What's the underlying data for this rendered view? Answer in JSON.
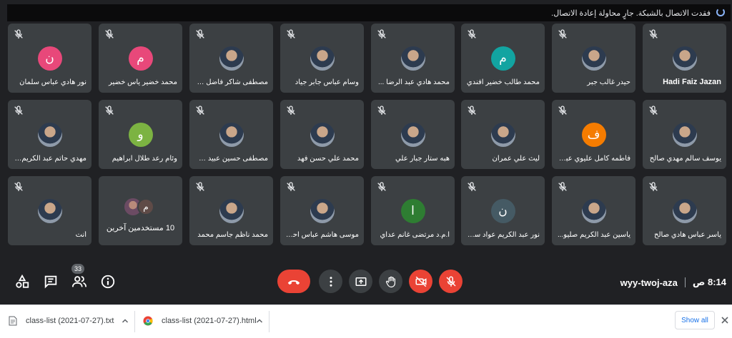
{
  "notification": {
    "text": "فقدت الاتصال بالشبكة. جارٍ محاولة إعادة الاتصال."
  },
  "tiles": [
    {
      "name": "Hadi Faiz Jazan",
      "avatar": "photo",
      "color": "",
      "letter": "",
      "ltr": true
    },
    {
      "name": "حيدر غالب جبر",
      "avatar": "photo",
      "color": "",
      "letter": ""
    },
    {
      "name": "محمد طالب خضير افندي",
      "avatar": "letter",
      "color": "#12a4a1",
      "letter": "م"
    },
    {
      "name": "محمد هادي عبد الرضا ...",
      "avatar": "photo",
      "color": "",
      "letter": ""
    },
    {
      "name": "وسام عباس جابر جياد",
      "avatar": "photo",
      "color": "",
      "letter": ""
    },
    {
      "name": "مصطفى شاكر فاضل ع...",
      "avatar": "photo",
      "color": "",
      "letter": ""
    },
    {
      "name": "محمد خضير ياس خضير",
      "avatar": "letter",
      "color": "#e8487a",
      "letter": "م"
    },
    {
      "name": "نور هادي عباس سلمان",
      "avatar": "letter",
      "color": "#e8487a",
      "letter": "ن"
    },
    {
      "name": "يوسف سالم مهدي صالح",
      "avatar": "photo",
      "color": "",
      "letter": ""
    },
    {
      "name": "فاطمه كامل عليوي عباس",
      "avatar": "letter",
      "color": "#f57c00",
      "letter": "ف"
    },
    {
      "name": "ليث علي عمران",
      "avatar": "photo",
      "color": "",
      "letter": ""
    },
    {
      "name": "هبه ستار جبار علي",
      "avatar": "photo",
      "color": "",
      "letter": ""
    },
    {
      "name": "محمد علي حسن فهد",
      "avatar": "photo",
      "color": "",
      "letter": ""
    },
    {
      "name": "مصطفى حسين عبيد خليف",
      "avatar": "photo",
      "color": "",
      "letter": ""
    },
    {
      "name": "وئام رعد طلال ابراهيم",
      "avatar": "letter",
      "color": "#7cb342",
      "letter": "و"
    },
    {
      "name": "مهدي حاتم عبد الكريم ه...",
      "avatar": "photo",
      "color": "",
      "letter": ""
    },
    {
      "name": "ياسر عباس هادي صالح",
      "avatar": "photo",
      "color": "",
      "letter": ""
    },
    {
      "name": "ياسين عبد الكريم صليو...",
      "avatar": "photo",
      "color": "",
      "letter": ""
    },
    {
      "name": "نور عبد الكريم عواد سل...",
      "avatar": "letter",
      "color": "#455a64",
      "letter": "ن"
    },
    {
      "name": "ا.م.د مرتضى غانم عداي",
      "avatar": "letter",
      "color": "#2e7d32",
      "letter": "ا"
    },
    {
      "name": "موسى هاشم عباس احمد",
      "avatar": "photo",
      "color": "",
      "letter": ""
    },
    {
      "name": "محمد ناظم جاسم محمد",
      "avatar": "photo",
      "color": "",
      "letter": ""
    },
    {
      "name": "10 مستخدمين آخرين",
      "avatar": "others",
      "color": "",
      "letter": "م"
    },
    {
      "name": "أنت",
      "avatar": "photo",
      "color": "",
      "letter": ""
    }
  ],
  "controls": {
    "people_count": "33",
    "meeting_code": "wyy-twoj-aza",
    "time": "8:14 ص"
  },
  "downloads": [
    {
      "filename": "class-list (2021-07-27).txt",
      "type": "txt"
    },
    {
      "filename": "class-list (2021-07-27).html",
      "type": "html"
    }
  ],
  "shelf": {
    "show_all": "Show all"
  }
}
